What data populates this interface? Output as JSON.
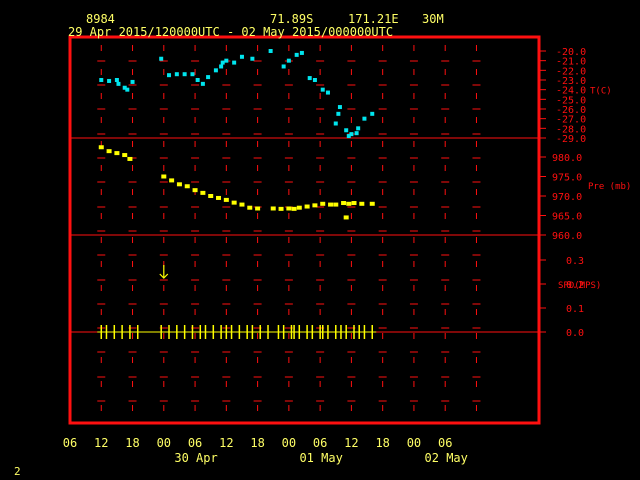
{
  "header": {
    "station": "8984",
    "lat": "71.89S",
    "lon": "171.21E",
    "elev": "30M",
    "range": "29 Apr 2015/120000UTC - 02 May 2015/000000UTC"
  },
  "footer": {
    "page_number": "2"
  },
  "colors": {
    "frame": "#ff1010",
    "text": "#ffff66",
    "temp": "#00e5ee",
    "pres": "#ffff00"
  },
  "chart_data": {
    "type": "scatter",
    "x_axis": {
      "unit": "hours",
      "range": [
        -6,
        84
      ],
      "tick_labels": [
        "06",
        "12",
        "18",
        "00",
        "06",
        "12",
        "18",
        "00",
        "06",
        "12",
        "18",
        "00",
        "06"
      ],
      "date_labels": [
        "30 Apr",
        "01 May",
        "02 May"
      ]
    },
    "panels": [
      {
        "name": "temperature",
        "ylabel": "T(C)",
        "ylim": [
          -29,
          -20
        ],
        "tick_labels": [
          "-20.0",
          "-21.0",
          "-22.0",
          "-23.0",
          "-24.0",
          "-25.0",
          "-26.0",
          "-27.0",
          "-28.0",
          "-29.0"
        ],
        "points": [
          [
            0,
            -23.0
          ],
          [
            1.5,
            -23.1
          ],
          [
            3,
            -23.0
          ],
          [
            3.3,
            -23.4
          ],
          [
            4.5,
            -23.8
          ],
          [
            5,
            -24.0
          ],
          [
            6,
            -23.2
          ],
          [
            11.5,
            -20.8
          ],
          [
            13,
            -22.5
          ],
          [
            14.5,
            -22.4
          ],
          [
            16,
            -22.4
          ],
          [
            17.5,
            -22.4
          ],
          [
            18.5,
            -23.0
          ],
          [
            19.5,
            -23.4
          ],
          [
            20.5,
            -22.7
          ],
          [
            22,
            -22.0
          ],
          [
            23,
            -21.6
          ],
          [
            23.3,
            -21.2
          ],
          [
            24,
            -21.0
          ],
          [
            25.5,
            -21.2
          ],
          [
            27,
            -20.6
          ],
          [
            29,
            -20.8
          ],
          [
            32.5,
            -20.0
          ],
          [
            35,
            -21.6
          ],
          [
            36,
            -21.0
          ],
          [
            37.5,
            -20.4
          ],
          [
            38.5,
            -20.2
          ],
          [
            40,
            -22.8
          ],
          [
            41,
            -23.0
          ],
          [
            42.5,
            -24.0
          ],
          [
            43.5,
            -24.3
          ],
          [
            45,
            -27.5
          ],
          [
            45.5,
            -26.5
          ],
          [
            45.8,
            -25.8
          ],
          [
            47,
            -28.2
          ],
          [
            47.5,
            -28.8
          ],
          [
            48,
            -28.6
          ],
          [
            49,
            -28.5
          ],
          [
            49.3,
            -28.0
          ],
          [
            50.5,
            -27.0
          ],
          [
            52,
            -26.5
          ]
        ]
      },
      {
        "name": "pressure",
        "ylabel": "Pre (mb)",
        "ylim": [
          960,
          984
        ],
        "tick_labels": [
          "980.0",
          "975.0",
          "970.0",
          "965.0",
          "960.0"
        ],
        "points": [
          [
            0,
            982.5
          ],
          [
            1.5,
            981.5
          ],
          [
            3,
            981.0
          ],
          [
            4.5,
            980.5
          ],
          [
            5.5,
            979.5
          ],
          [
            12,
            975.0
          ],
          [
            13.5,
            974.0
          ],
          [
            15,
            973.0
          ],
          [
            16.5,
            972.5
          ],
          [
            18,
            971.5
          ],
          [
            19.5,
            970.8
          ],
          [
            21,
            970.0
          ],
          [
            22.5,
            969.5
          ],
          [
            24,
            969.0
          ],
          [
            25.5,
            968.3
          ],
          [
            27,
            967.8
          ],
          [
            28.5,
            967.0
          ],
          [
            30,
            966.8
          ],
          [
            33,
            966.8
          ],
          [
            34.5,
            966.7
          ],
          [
            36,
            966.8
          ],
          [
            37,
            966.7
          ],
          [
            38,
            967.0
          ],
          [
            39.5,
            967.3
          ],
          [
            41,
            967.6
          ],
          [
            42.5,
            968.0
          ],
          [
            44,
            967.8
          ],
          [
            45,
            967.8
          ],
          [
            46.5,
            968.2
          ],
          [
            47,
            964.5
          ],
          [
            47.5,
            968.0
          ],
          [
            48.5,
            968.2
          ],
          [
            50,
            968.0
          ],
          [
            52,
            968.0
          ]
        ]
      },
      {
        "name": "wind",
        "ylabel": "SPD(MPS)",
        "ylim": [
          0,
          0.35
        ],
        "tick_labels": [
          "0.3",
          "0.2",
          "0.1",
          "0.0"
        ],
        "wind_arrow": [
          12,
          0.25
        ],
        "calm_obs": [
          0,
          1,
          2.5,
          4,
          5.5,
          7,
          11.5,
          13,
          14.5,
          16,
          17.5,
          19,
          20,
          21.5,
          23,
          24,
          25,
          26.5,
          28,
          29,
          30.5,
          32,
          34,
          35,
          36.5,
          37,
          38,
          39.5,
          40.5,
          42,
          42.5,
          43.5,
          45,
          46,
          47,
          48.5,
          49.5,
          50.5,
          52
        ]
      }
    ]
  }
}
